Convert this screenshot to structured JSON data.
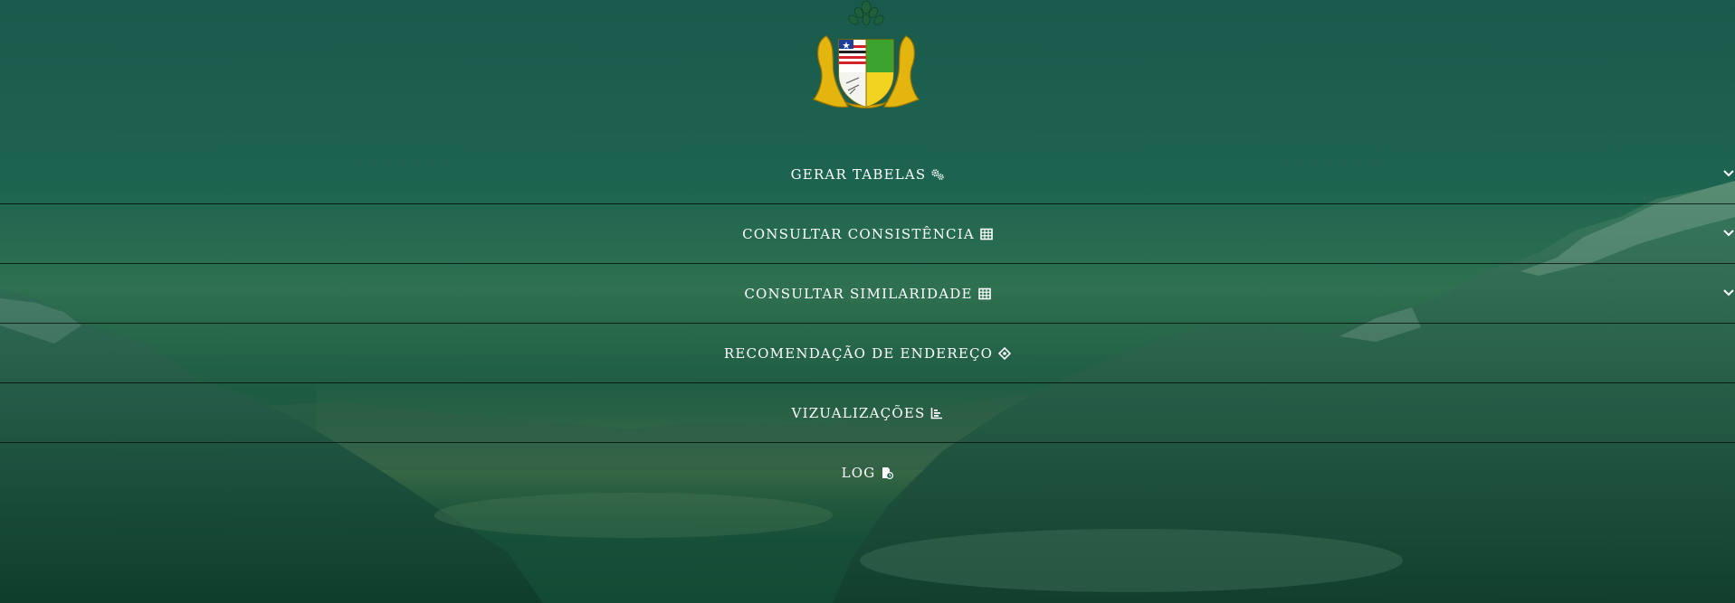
{
  "background": {
    "scene": "mountain-valley-landscape",
    "overlay_color": "#1a5e4a"
  },
  "logo": {
    "name": "state-coat-of-arms"
  },
  "menu": {
    "items": [
      {
        "label": "GERAR TABELAS",
        "icon": "gears-icon",
        "has_dropdown": true
      },
      {
        "label": "CONSULTAR CONSISTÊNCIA",
        "icon": "table-icon",
        "has_dropdown": true
      },
      {
        "label": "CONSULTAR SIMILARIDADE",
        "icon": "table-icon",
        "has_dropdown": true
      },
      {
        "label": "RECOMENDAÇÃO DE ENDEREÇO",
        "icon": "crosshairs-icon",
        "has_dropdown": false
      },
      {
        "label": "VIZUALIZAÇÕES",
        "icon": "bar-chart-icon",
        "has_dropdown": false
      },
      {
        "label": "LOG",
        "icon": "file-clock-icon",
        "has_dropdown": false
      }
    ]
  },
  "colors": {
    "text": "#ffffff",
    "divider": "#000000"
  }
}
